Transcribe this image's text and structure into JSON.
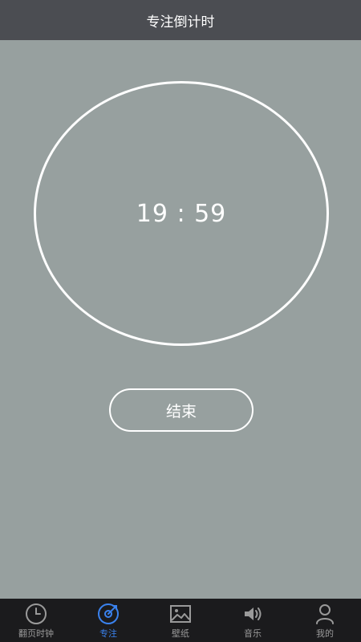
{
  "header": {
    "title": "专注倒计时"
  },
  "timer": {
    "display": "19 : 59"
  },
  "actions": {
    "end_label": "结束"
  },
  "tabs": [
    {
      "label": "翻页时钟",
      "icon": "clock-icon",
      "active": false
    },
    {
      "label": "专注",
      "icon": "focus-target-icon",
      "active": true
    },
    {
      "label": "壁纸",
      "icon": "image-icon",
      "active": false
    },
    {
      "label": "音乐",
      "icon": "speaker-icon",
      "active": false
    },
    {
      "label": "我的",
      "icon": "user-icon",
      "active": false
    }
  ],
  "colors": {
    "background": "#97a09f",
    "title_bar": "#4b4d52",
    "tab_bar": "#1b1b1d",
    "accent": "#3a82ee",
    "inactive": "#9a9a9a"
  }
}
